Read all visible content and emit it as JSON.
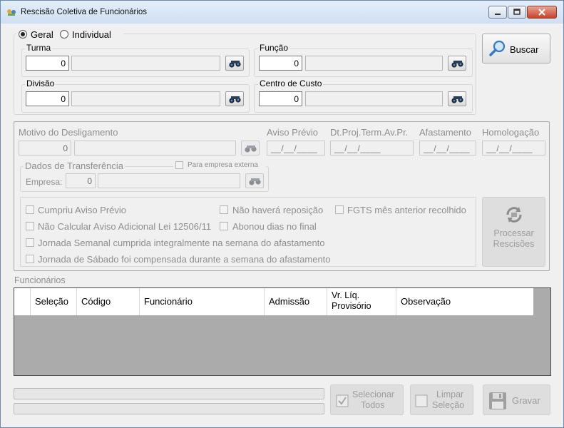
{
  "window": {
    "title": "Rescisão Coletiva de Funcionários"
  },
  "filtro": {
    "radio_geral": "Geral",
    "radio_individual": "Individual",
    "selected": "Geral",
    "turma": {
      "label": "Turma",
      "value": "0",
      "desc": ""
    },
    "funcao": {
      "label": "Função",
      "value": "0",
      "desc": ""
    },
    "divisao": {
      "label": "Divisão",
      "value": "0",
      "desc": ""
    },
    "centro_custo": {
      "label": "Centro de Custo",
      "value": "0",
      "desc": ""
    },
    "buscar_label": "Buscar"
  },
  "desligamento": {
    "motivo_label": "Motivo do Desligamento",
    "motivo_value": "0",
    "aviso_previo_label": "Aviso Prévio",
    "aviso_previo_value": "__/__/____",
    "dt_proj_label": "Dt.Proj.Term.Av.Pr.",
    "dt_proj_value": "__/__/____",
    "afastamento_label": "Afastamento",
    "afastamento_value": "__/__/____",
    "homologacao_label": "Homologação",
    "homologacao_value": "__/__/____",
    "transferencia": {
      "label": "Dados de Transferência",
      "para_empresa_externa": "Para empresa externa",
      "empresa_label": "Empresa:",
      "empresa_value": "0"
    },
    "opcoes": {
      "cumpriu_aviso": "Cumpriu Aviso Prévio",
      "nao_havera_reposicao": "Não haverá reposição",
      "fgts_mes_anterior": "FGTS mês anterior recolhido",
      "nao_calcular_aviso": "Não Calcular Aviso Adicional Lei 12506/11",
      "abonou_dias": "Abonou dias no final",
      "jornada_semanal": "Jornada Semanal cumprida integralmente na semana do afastamento",
      "jornada_sabado": "Jornada de Sábado foi compensada durante a semana do afastamento"
    },
    "processar_label_1": "Processar",
    "processar_label_2": "Rescisões"
  },
  "funcionarios": {
    "label": "Funcionários",
    "columns": {
      "selecao": "Seleção",
      "codigo": "Código",
      "funcionario": "Funcionário",
      "admissao": "Admissão",
      "vr_liq_1": "Vr. Líq.",
      "vr_liq_2": "Provisório",
      "observacao": "Observação"
    }
  },
  "footer": {
    "selecionar_1": "Selecionar",
    "selecionar_2": "Todos",
    "limpar_1": "Limpar",
    "limpar_2": "Seleção",
    "gravar": "Gravar"
  }
}
